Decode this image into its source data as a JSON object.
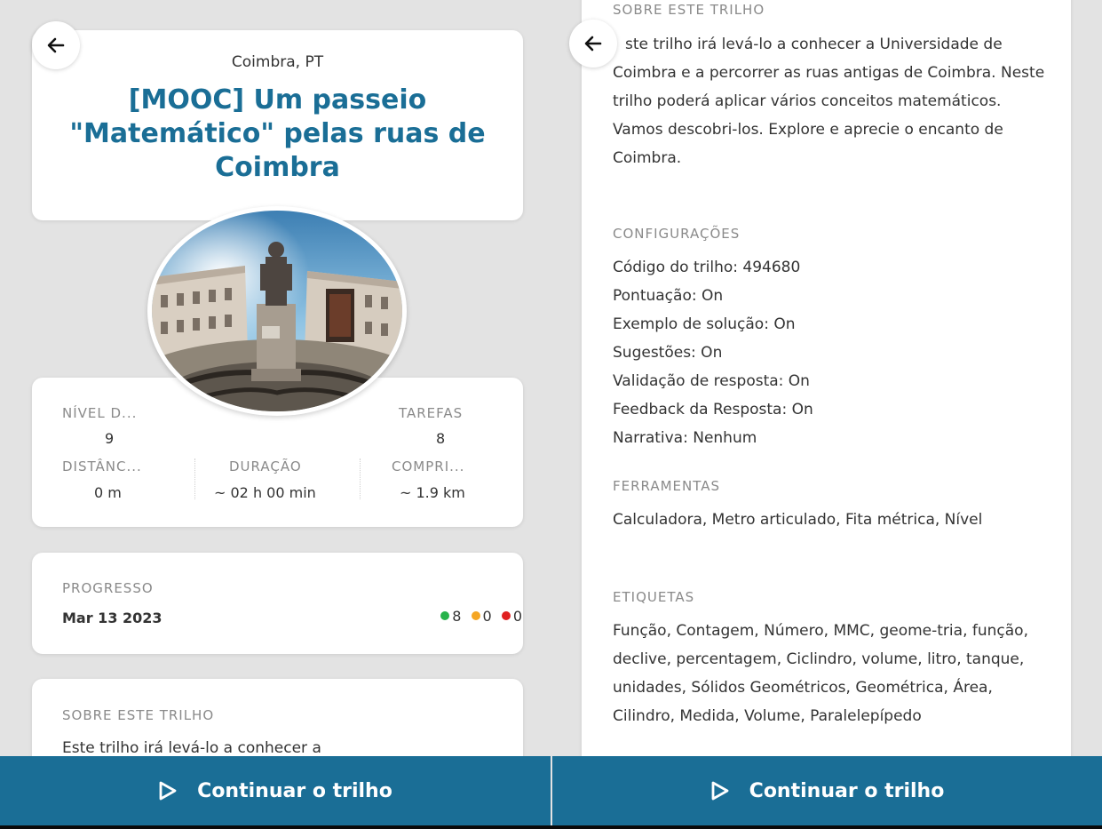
{
  "left": {
    "location": "Coimbra, PT",
    "title": "[MOOC] Um passeio \"Matemático\" pelas ruas de Coimbra",
    "stats": {
      "level_label": "NÍVEL D...",
      "level_value": "9",
      "tasks_label": "TAREFAS",
      "tasks_value": "8",
      "distance_label": "DISTÂNC...",
      "distance_value": "0 m",
      "duration_label": "DURAÇÃO",
      "duration_value": "~ 02 h 00 min",
      "length_label": "COMPRI...",
      "length_value": "~ 1.9 km"
    },
    "progress": {
      "label": "PROGRESSO",
      "date": "Mar 13 2023",
      "green_count": "8",
      "yellow_count": "0",
      "red_count": "0"
    },
    "about": {
      "label": "SOBRE ESTE TRILHO",
      "text": "Este trilho irá levá-lo a conhecer a"
    }
  },
  "right": {
    "about_label": "SOBRE ESTE TRILHO",
    "about_text": "ste trilho irá levá-lo a conhecer a Universidade de Coimbra e a percorrer as ruas antigas de Coimbra. Neste trilho poderá aplicar vários conceitos matemáticos. Vamos descobri-los. Explore e aprecie o encanto de Coimbra.",
    "config_label": "CONFIGURAÇÕES",
    "config": [
      "Código do trilho: 494680",
      "Pontuação: On",
      "Exemplo de solução: On",
      "Sugestões: On",
      "Validação de resposta: On",
      "Feedback da Resposta: On",
      "Narrativa: Nenhum"
    ],
    "tools_label": "FERRAMENTAS",
    "tools_text": "Calculadora, Metro articulado, Fita métrica, Nível",
    "tags_label": "ETIQUETAS",
    "tags_text": "Função, Contagem, Número, MMC, geome-tria, função, declive, percentagem, Ciclindro, volume, litro, tanque, unidades, Sólidos Geométricos, Geométrica, Área, Cilindro, Medida, Volume, Paralelepípedo"
  },
  "cta_label": "Continuar o trilho",
  "colors": {
    "accent": "#1a6e96",
    "green": "#27b34a",
    "yellow": "#f5a623",
    "red": "#e02020"
  },
  "icons": {
    "back": "arrow-left-icon",
    "play": "play-outline-icon"
  }
}
